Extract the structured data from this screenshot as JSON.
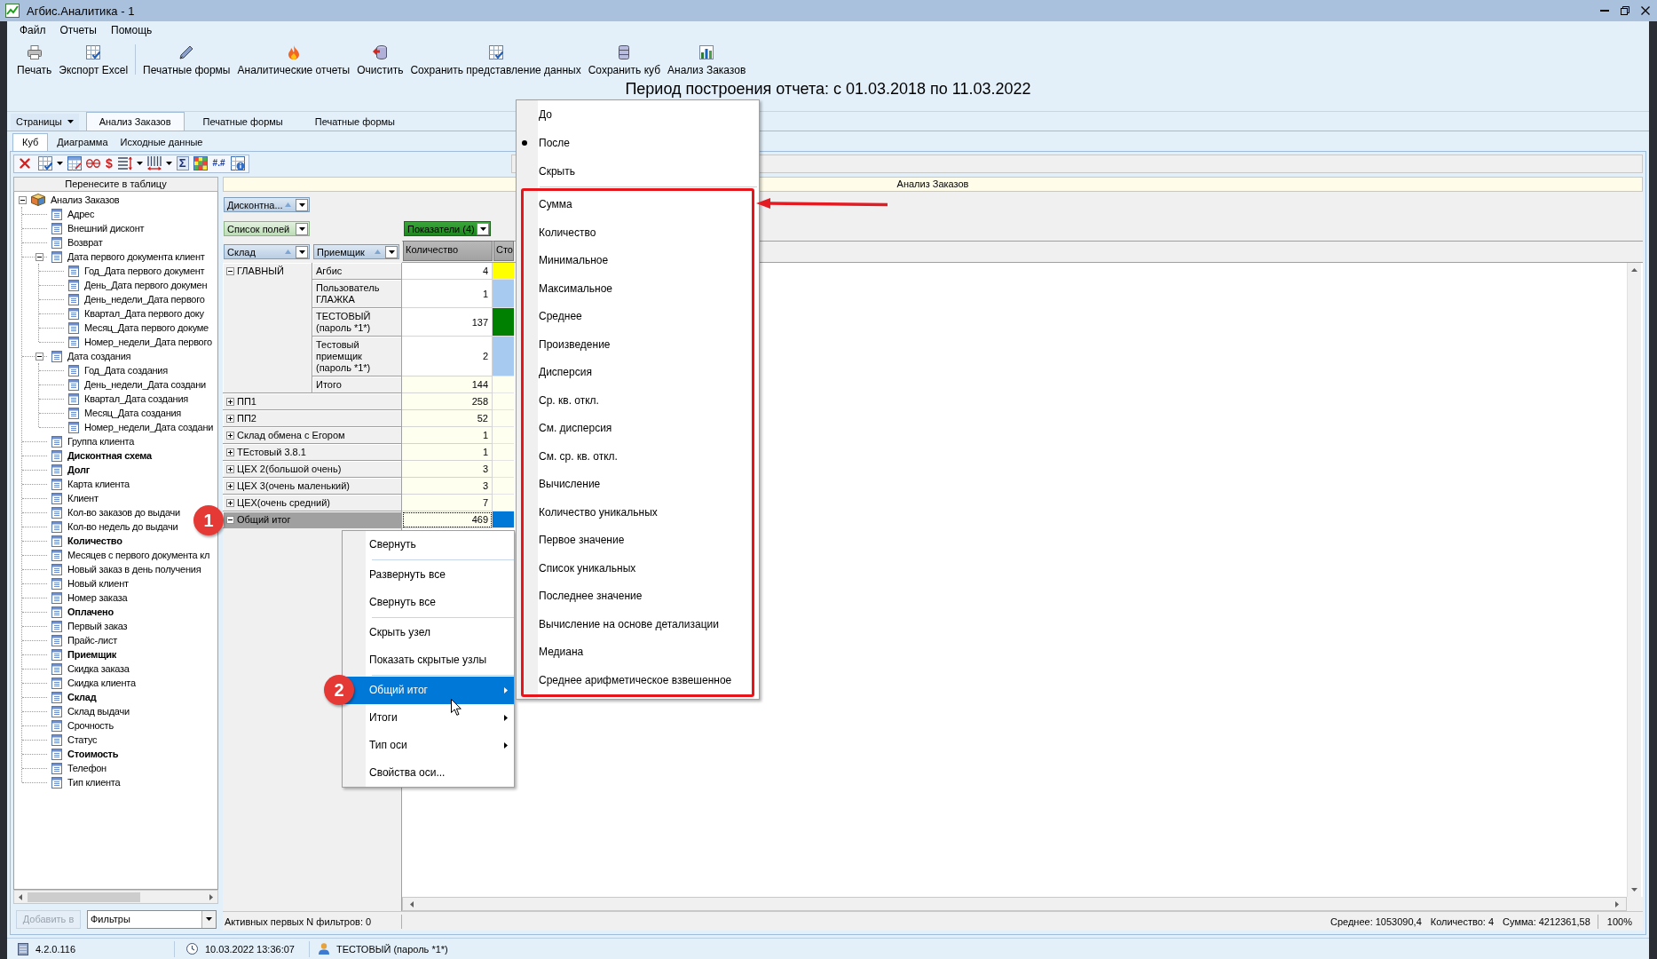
{
  "window": {
    "title": "Агбис.Аналитика - 1"
  },
  "menu": [
    "Файл",
    "Отчеты",
    "Помощь"
  ],
  "toolbar": [
    [
      {
        "label": "Печать"
      },
      {
        "label": "Экспорт Excel"
      }
    ],
    [
      {
        "label": "Печатные формы"
      },
      {
        "label": "Аналитические отчеты"
      },
      {
        "label": "Очистить"
      },
      {
        "label": "Сохранить представление данных"
      },
      {
        "label": "Сохранить куб"
      },
      {
        "label": "Анализ Заказов"
      }
    ]
  ],
  "report_period": "Период построения отчета: с 01.03.2018 по 11.03.2022",
  "page_tabs": {
    "menu": "Страницы",
    "tabs": [
      {
        "label": "Анализ Заказов",
        "selected": true
      },
      {
        "label": "Печатные формы",
        "selected": false
      },
      {
        "label": "Печатные формы",
        "selected": false
      }
    ]
  },
  "view_tabs": [
    {
      "label": "Куб",
      "selected": true
    },
    {
      "label": "Диаграмма",
      "selected": false
    },
    {
      "label": "Исходные данные",
      "selected": false
    }
  ],
  "pivot_toolbar": {
    "glyphs": [
      "$",
      "Σ",
      "#.#"
    ]
  },
  "field_panel": {
    "title": "Перенесите в таблицу",
    "tree": [
      {
        "label": "Анализ Заказов",
        "expanded": true,
        "in_use": false,
        "children": [
          {
            "label": "Адрес",
            "in_use": false
          },
          {
            "label": "Внешний дисконт",
            "in_use": false
          },
          {
            "label": "Возврат",
            "in_use": false
          },
          {
            "label": "Дата первого документа клиент",
            "in_use": false,
            "expanded": true,
            "children": [
              {
                "label": "Год_Дата первого документ",
                "in_use": false
              },
              {
                "label": "День_Дата первого докумен",
                "in_use": false
              },
              {
                "label": "День_недели_Дата первого",
                "in_use": false
              },
              {
                "label": "Квартал_Дата первого доку",
                "in_use": false
              },
              {
                "label": "Месяц_Дата первого докуме",
                "in_use": false
              },
              {
                "label": "Номер_недели_Дата первого",
                "in_use": false
              }
            ]
          },
          {
            "label": "Дата создания",
            "in_use": false,
            "expanded": true,
            "children": [
              {
                "label": "Год_Дата создания",
                "in_use": false
              },
              {
                "label": "День_недели_Дата создани",
                "in_use": false
              },
              {
                "label": "Квартал_Дата создания",
                "in_use": false
              },
              {
                "label": "Месяц_Дата создания",
                "in_use": false
              },
              {
                "label": "Номер_недели_Дата создани",
                "in_use": false
              }
            ]
          },
          {
            "label": "Группа клиента",
            "in_use": false
          },
          {
            "label": "Дисконтная схема",
            "in_use": true
          },
          {
            "label": "Долг",
            "in_use": true
          },
          {
            "label": "Карта клиента",
            "in_use": false
          },
          {
            "label": "Клиент",
            "in_use": false
          },
          {
            "label": "Кол-во заказов до выдачи",
            "in_use": false
          },
          {
            "label": "Кол-во недель до выдачи",
            "in_use": false
          },
          {
            "label": "Количество",
            "in_use": true
          },
          {
            "label": "Месяцев с первого документа кл",
            "in_use": false
          },
          {
            "label": "Новый заказ в день получения",
            "in_use": false
          },
          {
            "label": "Новый клиент",
            "in_use": false
          },
          {
            "label": "Номер заказа",
            "in_use": false
          },
          {
            "label": "Оплачено",
            "in_use": true
          },
          {
            "label": "Первый заказ",
            "in_use": false
          },
          {
            "label": "Прайс-лист",
            "in_use": false
          },
          {
            "label": "Приемщик",
            "in_use": true
          },
          {
            "label": "Скидка заказа",
            "in_use": false
          },
          {
            "label": "Скидка клиента",
            "in_use": false
          },
          {
            "label": "Склад",
            "in_use": true
          },
          {
            "label": "Склад выдачи",
            "in_use": false
          },
          {
            "label": "Срочность",
            "in_use": false
          },
          {
            "label": "Статус",
            "in_use": false
          },
          {
            "label": "Стоимость",
            "in_use": true
          },
          {
            "label": "Телефон",
            "in_use": false
          },
          {
            "label": "Тип клиента",
            "in_use": false
          }
        ]
      }
    ],
    "add_button": {
      "label": "Добавить в",
      "disabled": true
    },
    "target": "Фильтры"
  },
  "pivot": {
    "title": "Анализ Заказов",
    "filter_fields": [
      {
        "label": "Дисконтна...",
        "sorted": true
      }
    ],
    "field_list": "Список полей",
    "measures": "Показатели (4)",
    "row_fields": [
      {
        "label": "Склад",
        "sorted": true
      },
      {
        "label": "Приемщик",
        "sorted": true
      }
    ],
    "columns": [
      "Количество",
      "Сто"
    ],
    "rows": [
      {
        "label": "ГЛАВНЫЙ",
        "expanded": true,
        "selected": false,
        "children": [
          {
            "label": "Агбис",
            "kind": "detail",
            "value": "4",
            "color": "#ffff00",
            "selected": false
          },
          {
            "label": "Пользователь ГЛАЖКА",
            "kind": "detail",
            "value": "1",
            "color": "#a6caf0",
            "selected": false
          },
          {
            "label": "ТЕСТОВЫЙ (пароль *1*)",
            "kind": "detail",
            "value": "137",
            "color": "#008000",
            "selected": false
          },
          {
            "label": "Тестовый приемщик (пароль *1*)",
            "kind": "detail",
            "value": "2",
            "color": "#a6caf0",
            "selected": false
          },
          {
            "label": "Итого",
            "kind": "total",
            "value": "144",
            "selected": false
          }
        ]
      },
      {
        "label": "ПП1",
        "expanded": false,
        "value": "258",
        "selected": false
      },
      {
        "label": "ПП2",
        "expanded": false,
        "value": "52",
        "selected": false
      },
      {
        "label": "Склад обмена с Егором",
        "expanded": false,
        "value": "1",
        "selected": false
      },
      {
        "label": "ТЕстовый 3.8.1",
        "expanded": false,
        "value": "1",
        "selected": false
      },
      {
        "label": "ЦЕХ 2(большой очень)",
        "expanded": false,
        "value": "3",
        "selected": false
      },
      {
        "label": "ЦЕХ 3(очень маленький)",
        "expanded": false,
        "value": "3",
        "selected": false
      },
      {
        "label": "ЦЕХ(очень средний)",
        "expanded": false,
        "value": "7",
        "selected": false
      },
      {
        "label": "Общий итог",
        "expanded": true,
        "value": "469",
        "selected": true,
        "badge": "1"
      }
    ],
    "status": "Активных первых N фильтров: 0",
    "summary": [
      "Среднее: 1053090,4",
      "Количество: 4",
      "Сумма: 4212361,58"
    ],
    "zoom": "100%"
  },
  "context_menu": {
    "groups": [
      [
        {
          "label": "Свернуть",
          "selected": false
        }
      ],
      [
        {
          "label": "Развернуть все",
          "selected": false
        },
        {
          "label": "Свернуть все",
          "selected": false
        }
      ],
      [
        {
          "label": "Скрыть узел",
          "selected": false
        },
        {
          "label": "Показать скрытые узлы",
          "selected": false
        }
      ],
      [
        {
          "label": "Общий итог",
          "selected": true,
          "submenu": true,
          "badge": "2"
        },
        {
          "label": "Итоги",
          "selected": false,
          "submenu": true
        },
        {
          "label": "Тип оси",
          "selected": false,
          "submenu": true
        },
        {
          "label": "Свойства оси...",
          "selected": false
        }
      ]
    ]
  },
  "submenu": {
    "groups": [
      {
        "items": [
          {
            "label": "До",
            "selected": false
          },
          {
            "label": "После",
            "selected": true
          },
          {
            "label": "Скрыть",
            "selected": false
          }
        ]
      },
      {
        "highlighted": true,
        "items": [
          {
            "label": "Сумма"
          },
          {
            "label": "Количество"
          },
          {
            "label": "Минимальное"
          },
          {
            "label": "Максимальное"
          },
          {
            "label": "Среднее"
          },
          {
            "label": "Произведение"
          },
          {
            "label": "Дисперсия"
          },
          {
            "label": "Ср. кв. откл."
          },
          {
            "label": "См. дисперсия"
          },
          {
            "label": "См. ср. кв. откл."
          },
          {
            "label": "Вычисление"
          },
          {
            "label": "Количество уникальных"
          },
          {
            "label": "Первое значение"
          },
          {
            "label": "Список уникальных"
          },
          {
            "label": "Последнее значение"
          },
          {
            "label": "Вычисление на основе детализации"
          },
          {
            "label": "Медиана"
          },
          {
            "label": "Среднее арифметическое взвешенное"
          }
        ]
      }
    ]
  },
  "status_bar": {
    "version": "4.2.0.116",
    "datetime": "10.03.2022 13:36:07",
    "user": "ТЕСТОВЫЙ (пароль *1*)"
  }
}
